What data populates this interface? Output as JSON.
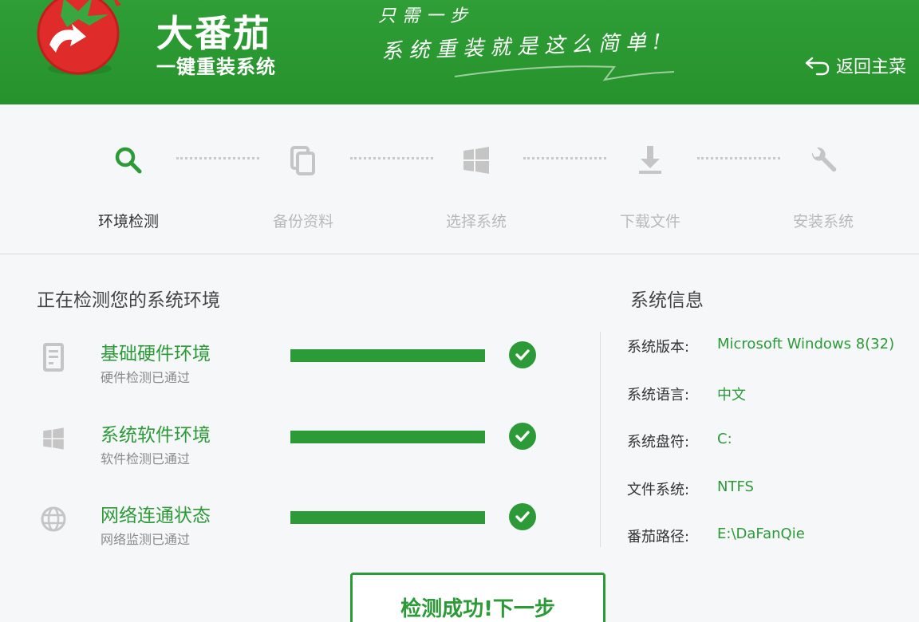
{
  "header": {
    "brand_name": "大番茄",
    "brand_sub": "一键重装系统",
    "slogan_line1": "只需一步",
    "slogan_line2": "系统重装就是这么简单!",
    "back_label": "返回主菜"
  },
  "steps": [
    {
      "label": "环境检测",
      "icon": "search-icon",
      "active": true
    },
    {
      "label": "备份资料",
      "icon": "copy-icon",
      "active": false
    },
    {
      "label": "选择系统",
      "icon": "windows-icon",
      "active": false
    },
    {
      "label": "下载文件",
      "icon": "download-icon",
      "active": false
    },
    {
      "label": "安装系统",
      "icon": "wrench-icon",
      "active": false
    }
  ],
  "detect": {
    "title": "正在检测您的系统环境",
    "items": [
      {
        "title": "基础硬件环境",
        "subtitle": "硬件检测已通过",
        "icon": "hardware-icon",
        "progress": 1.0,
        "status": "passed"
      },
      {
        "title": "系统软件环境",
        "subtitle": "软件检测已通过",
        "icon": "windows-icon",
        "progress": 1.0,
        "status": "passed"
      },
      {
        "title": "网络连通状态",
        "subtitle": "网络监测已通过",
        "icon": "globe-icon",
        "progress": 1.0,
        "status": "passed"
      }
    ]
  },
  "system_info": {
    "title": "系统信息",
    "rows": [
      {
        "key": "系统版本:",
        "value": "Microsoft Windows 8(32)"
      },
      {
        "key": "系统语言:",
        "value": "中文"
      },
      {
        "key": "系统盘符:",
        "value": "C:"
      },
      {
        "key": "文件系统:",
        "value": "NTFS"
      },
      {
        "key": "番茄路径:",
        "value": "E:\\DaFanQie"
      }
    ]
  },
  "next_button": {
    "label": "检测成功!下一步"
  },
  "colors": {
    "brand_green": "#2b9a37",
    "header_green": "#2f9e36",
    "logo_red": "#e02b2b"
  }
}
